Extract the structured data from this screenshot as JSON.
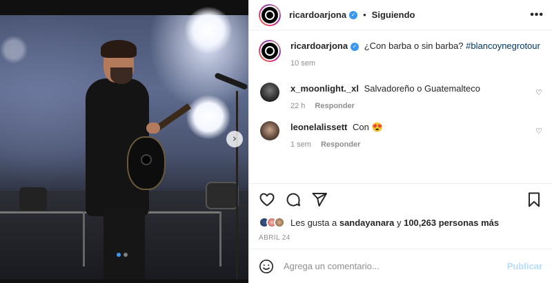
{
  "post": {
    "username": "ricardoarjona",
    "follow_status": "Siguiendo",
    "separator": "•",
    "more_icon": "•••",
    "caption_text": "¿Con barba o sin barba?",
    "caption_hashtag": "#blancoynegrotour",
    "caption_time": "10 sem"
  },
  "comments": [
    {
      "username": "x_moonlight._xl",
      "text": "Salvadoreño o Guatemalteco",
      "time": "22 h",
      "reply": "Responder",
      "avatar_color": "#3a3a3a"
    },
    {
      "username": "leonelalissett",
      "text": "Con 😍",
      "time": "1 sem",
      "reply": "Responder",
      "avatar_color": "#5c4638"
    }
  ],
  "likes": {
    "prefix": "Les gusta a",
    "user": "sandayanara",
    "joiner": "y",
    "count": "100,263 personas más"
  },
  "date": "ABRIL 24",
  "composer": {
    "placeholder": "Agrega un comentario...",
    "post_label": "Publicar"
  },
  "icons": {
    "verified": "✓",
    "heart_small": "♡",
    "next": "›"
  },
  "colors": {
    "accent": "#3897f0",
    "hashtag": "#00376b",
    "muted": "#8e8e8e",
    "post_disabled": "#b3dbff"
  }
}
